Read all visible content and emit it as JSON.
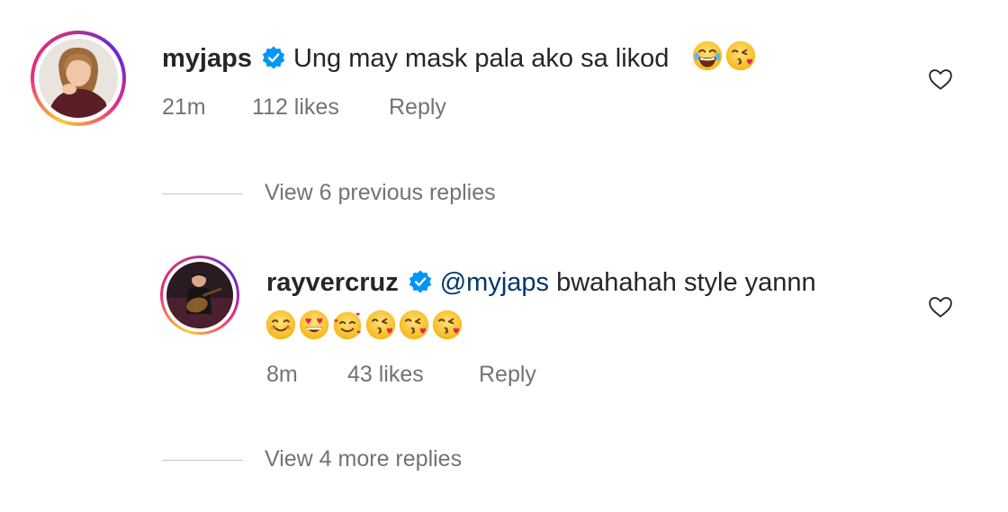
{
  "comments": [
    {
      "username": "myjaps",
      "text": "Ung may mask pala ako sa likod",
      "emojis": [
        "laughing-face",
        "face-blowing-kiss"
      ],
      "time": "21m",
      "likes": "112 likes",
      "reply_label": "Reply",
      "verified": true
    },
    {
      "username": "rayvercruz",
      "mention": "@myjaps",
      "text": "bwahahah style yannn",
      "emojis": [
        "smiling-face",
        "heart-eyes-face",
        "smiling-face-with-hearts",
        "face-blowing-kiss",
        "face-blowing-kiss",
        "face-blowing-kiss"
      ],
      "time": "8m",
      "likes": "43 likes",
      "reply_label": "Reply",
      "verified": true
    }
  ],
  "view_previous_replies": "View 6 previous replies",
  "view_more_replies": "View 4 more replies",
  "icons": {
    "like": "heart-outline-icon",
    "verified": "verified-badge-icon"
  },
  "colors": {
    "text": "#262626",
    "meta": "#737373",
    "mention": "#00376b",
    "verified": "#0095f6"
  }
}
